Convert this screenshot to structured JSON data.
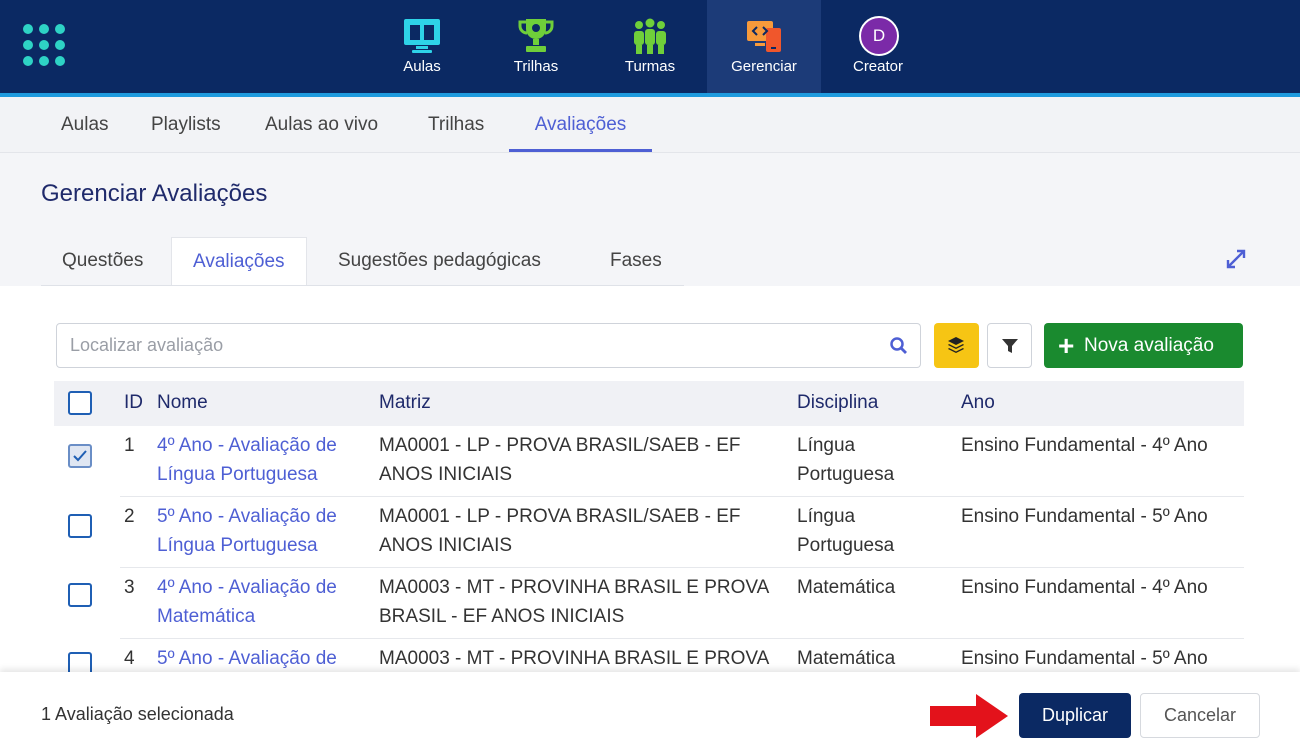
{
  "topnav": {
    "items": [
      {
        "label": "Aulas",
        "icon": "monitor-book-icon"
      },
      {
        "label": "Trilhas",
        "icon": "trophy-icon"
      },
      {
        "label": "Turmas",
        "icon": "people-icon"
      },
      {
        "label": "Gerenciar",
        "icon": "manage-devices-icon"
      },
      {
        "label": "Creator",
        "icon": "avatar",
        "avatar_letter": "D"
      }
    ],
    "active": "Gerenciar"
  },
  "subtabs": {
    "items": [
      "Aulas",
      "Playlists",
      "Aulas ao vivo",
      "Trilhas",
      "Avaliações"
    ],
    "active": "Avaliações"
  },
  "page": {
    "title": "Gerenciar Avaliações"
  },
  "inner_tabs": {
    "items": [
      "Questões",
      "Avaliações",
      "Sugestões pedagógicas",
      "Fases"
    ],
    "active": "Avaliações"
  },
  "toolbar": {
    "search_placeholder": "Localizar avaliação",
    "new_label": "Nova avaliação"
  },
  "table": {
    "headers": {
      "id": "ID",
      "nome": "Nome",
      "matriz": "Matriz",
      "disciplina": "Disciplina",
      "ano": "Ano"
    },
    "rows": [
      {
        "checked": true,
        "id": "1",
        "nome": [
          "4º Ano - Avaliação de",
          "Língua Portuguesa"
        ],
        "matriz": [
          "MA0001 - LP - PROVA BRASIL/SAEB - EF",
          "ANOS INICIAIS"
        ],
        "disciplina": [
          "Língua",
          "Portuguesa"
        ],
        "ano": "Ensino Fundamental - 4º Ano"
      },
      {
        "checked": false,
        "id": "2",
        "nome": [
          "5º Ano - Avaliação de",
          "Língua Portuguesa"
        ],
        "matriz": [
          "MA0001 - LP - PROVA BRASIL/SAEB - EF",
          "ANOS INICIAIS"
        ],
        "disciplina": [
          "Língua",
          "Portuguesa"
        ],
        "ano": "Ensino Fundamental - 5º Ano"
      },
      {
        "checked": false,
        "id": "3",
        "nome": [
          "4º Ano - Avaliação de",
          "Matemática"
        ],
        "matriz": [
          "MA0003 - MT - PROVINHA BRASIL E PROVA",
          "BRASIL - EF ANOS INICIAIS"
        ],
        "disciplina": [
          "Matemática",
          ""
        ],
        "ano": "Ensino Fundamental - 4º Ano"
      },
      {
        "checked": false,
        "id": "4",
        "nome": [
          "5º Ano - Avaliação de",
          ""
        ],
        "matriz": [
          "MA0003 - MT - PROVINHA BRASIL E PROVA",
          ""
        ],
        "disciplina": [
          "Matemática",
          ""
        ],
        "ano": "Ensino Fundamental - 5º Ano"
      }
    ]
  },
  "footer": {
    "selected_text": "1 Avaliação selecionada",
    "duplicate_label": "Duplicar",
    "cancel_label": "Cancelar"
  },
  "colors": {
    "nav_bg": "#0b2963",
    "accent": "#4e5fd4",
    "success": "#1a8a2f",
    "warning": "#f6c514",
    "arrow": "#e3121b"
  }
}
